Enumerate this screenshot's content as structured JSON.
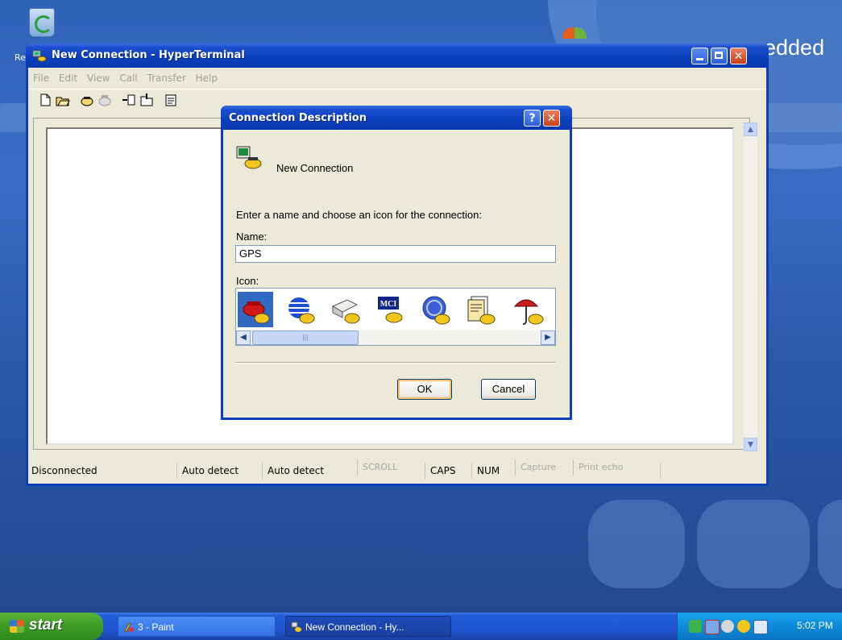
{
  "desktop": {
    "text_right": "edded",
    "recycle_label": "Re"
  },
  "window": {
    "title": "New Connection - HyperTerminal",
    "menu": [
      "File",
      "Edit",
      "View",
      "Call",
      "Transfer",
      "Help"
    ],
    "toolbar_icons": [
      "new-icon",
      "open-icon",
      "call-icon",
      "disconnect-icon",
      "send-icon",
      "receive-icon",
      "properties-icon"
    ],
    "status": {
      "connection": "Disconnected",
      "detect1": "Auto detect",
      "detect2": "Auto detect",
      "scroll": "SCROLL",
      "caps": "CAPS",
      "num": "NUM",
      "capture": "Capture",
      "print_echo": "Print echo"
    }
  },
  "dialog": {
    "title": "Connection Description",
    "help_btn": "?",
    "connection_name": "New Connection",
    "prompt": "Enter a name and choose an icon for the connection:",
    "name_label": "Name:",
    "name_value": "GPS",
    "icon_label": "Icon:",
    "icons": [
      "red-phone-icon",
      "blue-globe-icon",
      "printer-icon",
      "mci-icon",
      "ge-icon",
      "file-icon",
      "umbrella-icon"
    ],
    "selected_icon_index": 0,
    "icon_mci_text": "MCI",
    "ok": "OK",
    "cancel": "Cancel"
  },
  "taskbar": {
    "start": "start",
    "tasks": [
      {
        "label": "3 - Paint",
        "active": false
      },
      {
        "label": "New Connection - Hy...",
        "active": true
      }
    ],
    "clock": "5:02 PM"
  },
  "colors": {
    "titlebar": "#0a3fbc",
    "selection": "#316ac5",
    "taskbar": "#245edb",
    "start": "#3c9a24"
  }
}
